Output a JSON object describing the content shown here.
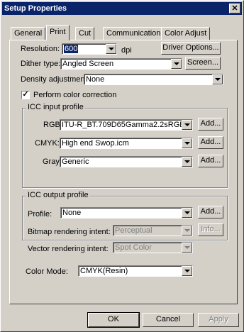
{
  "window": {
    "title": "Setup Properties",
    "close_glyph": "✕"
  },
  "tabs": [
    "General",
    "Print",
    "Cut",
    "Communication",
    "Color Adjust"
  ],
  "print": {
    "resolution_label": "Resolution:",
    "resolution_value": "600",
    "resolution_unit": "dpi",
    "driver_options_button": "Driver Options...",
    "dither_label": "Dither type:",
    "dither_value": "Angled Screen",
    "screen_button": "Screen...",
    "density_label": "Density adjustment:",
    "density_value": "None",
    "color_correction_label": "Perform color correction",
    "color_correction_checked": "✓"
  },
  "icc_input": {
    "group_label": "ICC input profile",
    "rgb_label": "RGB:",
    "rgb_value": "ITU-R_BT.709D65Gamma2.2sRGB.",
    "cmyk_label": "CMYK:",
    "cmyk_value": "High end Swop.icm",
    "gray_label": "Gray:",
    "gray_value": "Generic",
    "add_button": "Add..."
  },
  "icc_output": {
    "group_label": "ICC output profile",
    "profile_label": "Profile:",
    "profile_value": "None",
    "add_button": "Add...",
    "bitmap_label": "Bitmap rendering intent:",
    "bitmap_value": "Perceptual",
    "info_button": "Info...",
    "vector_label": "Vector rendering intent:",
    "vector_value": "Spot Color"
  },
  "color_mode": {
    "label": "Color Mode:",
    "value": "CMYK(Resin)"
  },
  "footer": {
    "ok": "OK",
    "cancel": "Cancel",
    "apply": "Apply"
  }
}
